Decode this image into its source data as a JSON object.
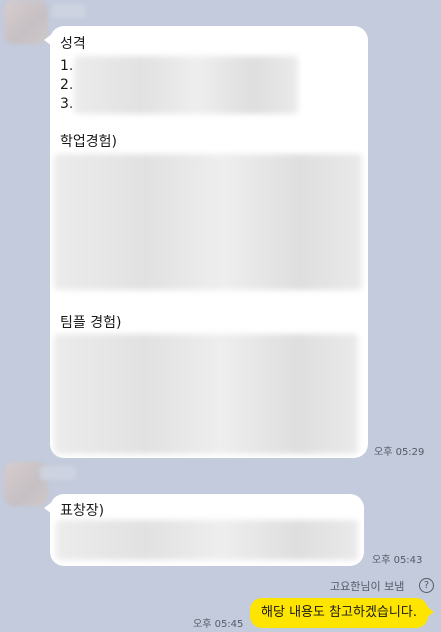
{
  "messages": {
    "first": {
      "line_title": "성격",
      "item1": "1.",
      "item2": "2.",
      "item3": "3.",
      "section_academic": "학업경험)",
      "section_team": "팀플 경험)",
      "time": "오후 05:29"
    },
    "second": {
      "section_award": "표창장)",
      "time": "오후 05:43"
    },
    "sent": {
      "sender_note": "고요한님이 보냄",
      "help_glyph": "?",
      "text": "해당 내용도 참고하겠습니다.",
      "time": "오후 05:45"
    }
  },
  "colors": {
    "chat_background": "#c3cbdc",
    "incoming_bubble": "#ffffff",
    "outgoing_bubble": "#fee500"
  }
}
